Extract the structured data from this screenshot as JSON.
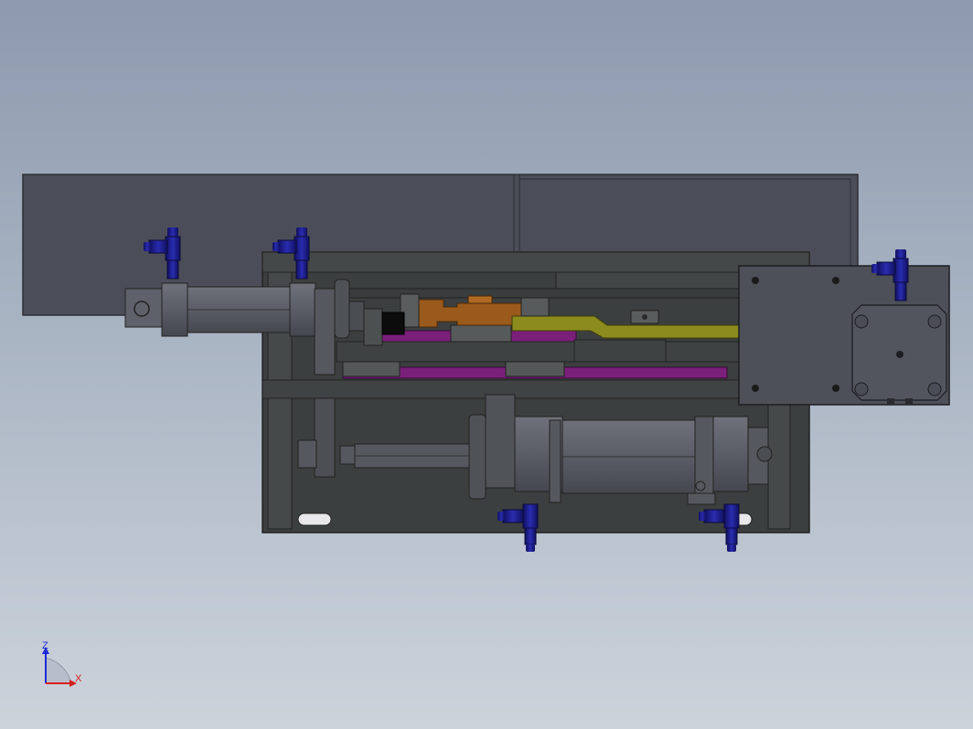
{
  "triad": {
    "z_label": "Z",
    "x_label": "X",
    "z_color": "#1f2bd6",
    "x_color": "#d61f1f"
  },
  "colors": {
    "background_top": "#8d9aae",
    "background_bottom": "#cdd3db",
    "panel": "#4b4d58",
    "frame": "#3c3f3f",
    "cylinder": "#5a5d66",
    "fitting": "#1e1f8a",
    "rail": "#7a1f7a",
    "bracket_orange": "#9a5a1c",
    "slide_yellow": "#8c8c1e"
  }
}
